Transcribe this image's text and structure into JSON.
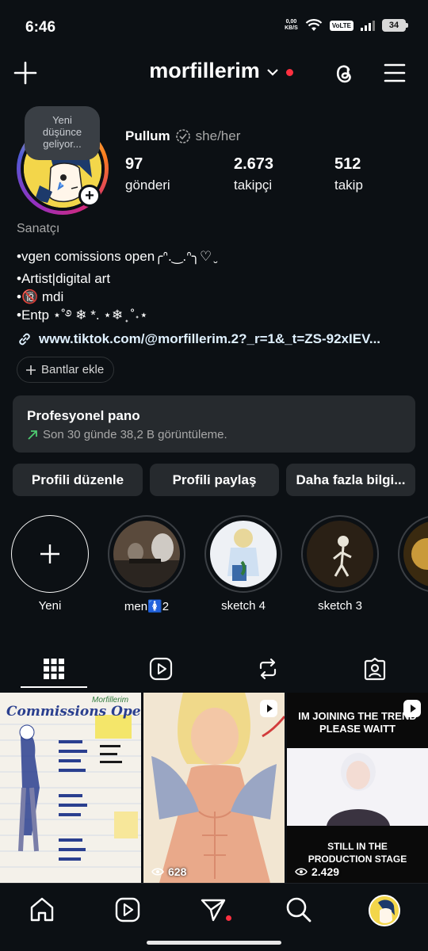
{
  "status_bar": {
    "time": "6:46",
    "net_speed_value": "0,00",
    "net_speed_unit": "KB/S",
    "volte": "VoLTE",
    "battery": "34"
  },
  "header": {
    "username": "morfillerim"
  },
  "profile": {
    "note_lines": [
      "Yeni",
      "düşünce",
      "geliyor..."
    ],
    "display_name": "Pullum",
    "pronouns": "she/her",
    "stats": [
      {
        "value": "97",
        "label": "gönderi"
      },
      {
        "value": "2.673",
        "label": "takipçi"
      },
      {
        "value": "512",
        "label": "takip"
      }
    ],
    "category": "Sanatçı",
    "bio_lines": [
      "•vgen comissions open╭ᐢ.‿.ᐢ╮♡ ̮",
      "•Artist|digital art",
      "•🔞 mdi",
      "•Entp ⋆˚࿔ ❄ *. ⋆❄ ̟ ˚˖⋆"
    ],
    "link": "www.tiktok.com/@morfillerim.2?_r=1&_t=ZS-92xIEV..."
  },
  "chip": {
    "label": "Bantlar ekle"
  },
  "dashboard": {
    "title": "Profesyonel pano",
    "subtitle": "Son 30 günde 38,2 B görüntüleme."
  },
  "actions": {
    "edit": "Profili düzenle",
    "share": "Profili paylaş",
    "more": "Daha fazla bilgi..."
  },
  "highlights": [
    {
      "label": "Yeni"
    },
    {
      "label": "men🚺2"
    },
    {
      "label": "sketch 4"
    },
    {
      "label": "sketch 3"
    }
  ],
  "posts": [
    {
      "views": "",
      "title": "Commissions Open",
      "brand": "Morfillerim"
    },
    {
      "views": "628"
    },
    {
      "views": "2.429",
      "top_text": "IM JOINING THE TREND PLEASE WAITT",
      "bottom_text": "STILL IN THE PRODUCTION STAGE"
    }
  ],
  "colors": {
    "background": "#0c1014",
    "surface": "#262a2e",
    "notification": "#ff3040",
    "link": "#e0f1ff"
  }
}
